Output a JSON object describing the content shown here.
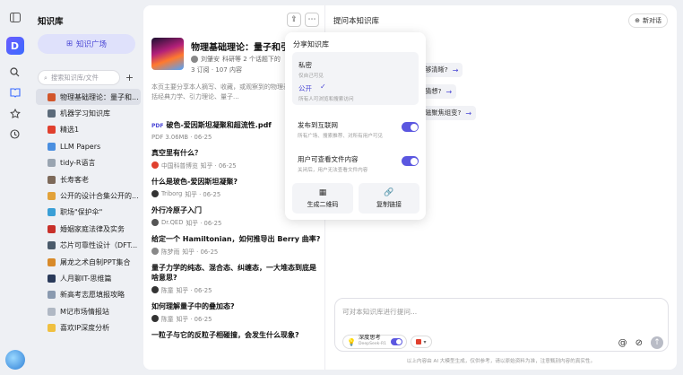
{
  "sidebar_rail": {
    "icons": [
      "panel-icon",
      "logo",
      "search-icon",
      "book-icon",
      "star-icon",
      "history-icon"
    ]
  },
  "kb_panel": {
    "title": "知识库",
    "square_label": "知识广场",
    "search_placeholder": "搜索知识库/文件",
    "items": [
      {
        "label": "物理基础理论：量子和...",
        "color": "#d2562b",
        "active": true
      },
      {
        "label": "机器学习知识库",
        "color": "#5c6b7a",
        "active": false
      },
      {
        "label": "精选1",
        "color": "#e0402e",
        "active": false
      },
      {
        "label": "LLM Papers",
        "color": "#4a8fe0",
        "active": false
      },
      {
        "label": "tidy-R语言",
        "color": "#9aa5b1",
        "active": false
      },
      {
        "label": "长寿客老",
        "color": "#7d6a5a",
        "active": false
      },
      {
        "label": "公开的设计合集公开的...",
        "color": "#e2a23a",
        "active": false
      },
      {
        "label": "职场\"保护伞\"",
        "color": "#3a9fd6",
        "active": false
      },
      {
        "label": "婚姻家庭法律及实务",
        "color": "#c8302a",
        "active": false
      },
      {
        "label": "芯片可靠性设计（DFT...",
        "color": "#4a5a6a",
        "active": false
      },
      {
        "label": "屠龙之术自制PPT集合",
        "color": "#d88a2a",
        "active": false
      },
      {
        "label": "人月聊IT-思维篇",
        "color": "#2a3a5a",
        "active": false
      },
      {
        "label": "新高考志愿填报攻略",
        "color": "#8a9ab0",
        "active": false
      },
      {
        "label": "M记市场情报站",
        "color": "#b0b8c4",
        "active": false
      },
      {
        "label": "喜欢IP深度分析",
        "color": "#f0c040",
        "active": false
      }
    ]
  },
  "doc_panel": {
    "kb_name": "物理基础理论：量子和引",
    "owner": "刘肇安",
    "owner_extra": "科研等 2 个话题下的",
    "stats": "3 订阅 · 107 内容",
    "description": "本页主要分享本人摘写、收藏，或观察到的物理基础理论，包括经典力学、引力理论、量子...",
    "documents": [
      {
        "title": "破色-爱因斯坦凝聚和超流性.pdf",
        "tag": "PDF",
        "meta": "PDF 3.06MB · 06-25",
        "src_color": "",
        "has_pdf": true
      },
      {
        "title": "真空里有什么？",
        "meta_src": "中国科普博览",
        "meta": "知乎 · 06-25",
        "src_color": "#e0402e"
      },
      {
        "title": "什么是玻色-爱因斯坦凝聚?",
        "meta_src": "Triborg",
        "meta": "知乎 · 06-25",
        "src_color": "#333"
      },
      {
        "title": "外行冷原子入门",
        "meta_src": "Dr.QED",
        "meta": "知乎 · 06-25",
        "src_color": "#555"
      },
      {
        "title": "给定一个 Hamiltonian，如何推导出 Berry 曲率?",
        "meta_src": "陈梦雨",
        "meta": "知乎 · 06-25",
        "src_color": "#888"
      },
      {
        "title": "量子力学的纯态、混合态、纠缠态，一大堆态到底是啥意思?",
        "meta_src": "陈童",
        "meta": "知乎 · 06-25",
        "src_color": "#333"
      },
      {
        "title": "如何理解量子中的叠加态?",
        "meta_src": "陈童",
        "meta": "知乎 · 06-25",
        "src_color": "#333"
      },
      {
        "title": "一粒子与它的反粒子相碰撞，会发生什么现象?",
        "meta_src": "",
        "meta": "",
        "src_color": ""
      }
    ]
  },
  "share_popup": {
    "title": "分享知识库",
    "private_label": "私密",
    "private_desc": "仅自己可见",
    "public_label": "公开",
    "public_desc": "所有人可浏览和搜索访问",
    "publish_label": "发布到互联网",
    "publish_desc": "所有广场、搜索推荐、对所有用户可见",
    "view_label": "用户可查看文件内容",
    "view_desc": "关闭后，用户无法查看文件内容",
    "qr_label": "生成二维码",
    "copy_label": "复制链接"
  },
  "chat_panel": {
    "title": "提问本知识库",
    "new_chat": "新对话",
    "suggestions": [
      "够清晰?",
      "猜想?",
      "磁聚焦组变?"
    ],
    "input_placeholder": "可对本知识库进行提问...",
    "deep_label": "深度思考",
    "deep_sub": "DeepSeek-R1",
    "disclaimer": "以上内容由 AI 大模型生成，仅供参考，请以原始资料为准，注意甄别内容的真实性。"
  }
}
